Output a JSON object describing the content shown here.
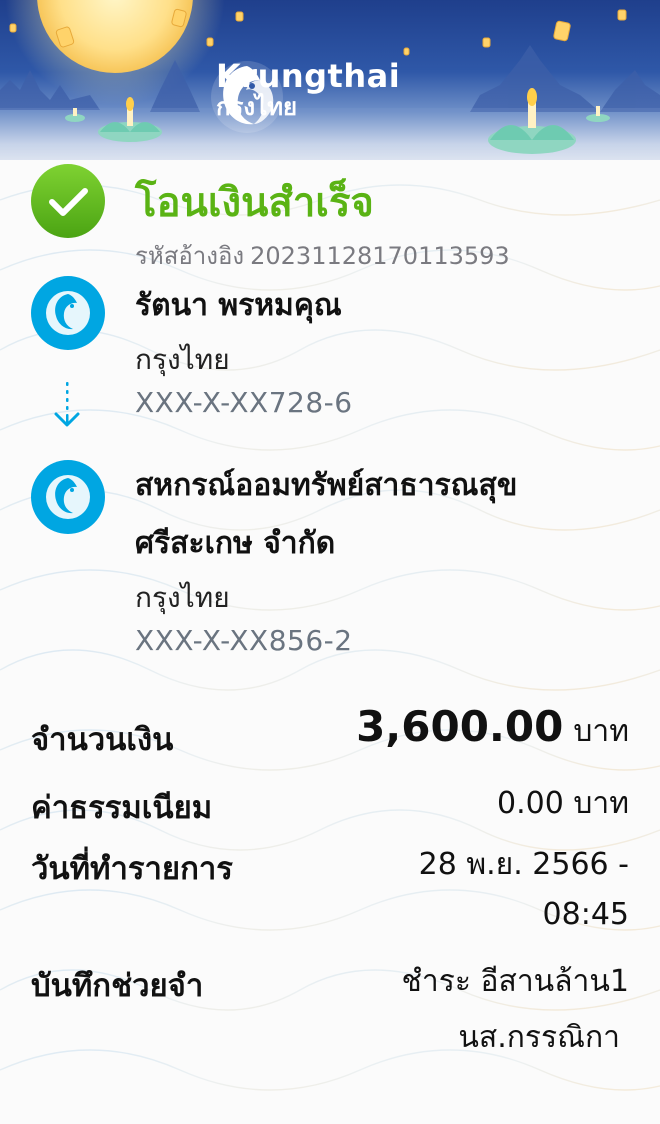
{
  "header": {
    "brand_name_en": "Krungthai",
    "brand_name_th": "กรุงไทย",
    "colors": {
      "top": "#1f3f8c",
      "accent": "#00a9e0"
    }
  },
  "status": {
    "title": "โอนเงินสำเร็จ",
    "icon": "check-circle-icon",
    "color": "#5ab314"
  },
  "reference": {
    "label": "รหัสอ้างอิง",
    "value": "20231128170113593"
  },
  "sender": {
    "name": "รัตนา พรหมคุณ",
    "bank": "กรุงไทย",
    "account": "XXX-X-XX728-6"
  },
  "receiver": {
    "name_line1": "สหกรณ์ออมทรัพย์สาธารณสุข",
    "name_line2": "ศรีสะเกษ จำกัด",
    "bank": "กรุงไทย",
    "account": "XXX-X-XX856-2"
  },
  "details": {
    "amount_label": "จำนวนเงิน",
    "amount_value": "3,600.00",
    "amount_unit": "บาท",
    "fee_label": "ค่าธรรมเนียม",
    "fee_value": "0.00 บาท",
    "date_label": "วันที่ทำรายการ",
    "date_line1": "28 พ.ย. 2566 -",
    "date_line2": "08:45",
    "memo_label": "บันทึกช่วยจำ",
    "memo_line1": "ชำระ อีสานล้าน1",
    "memo_line2": "นส.กรรณิกา"
  }
}
